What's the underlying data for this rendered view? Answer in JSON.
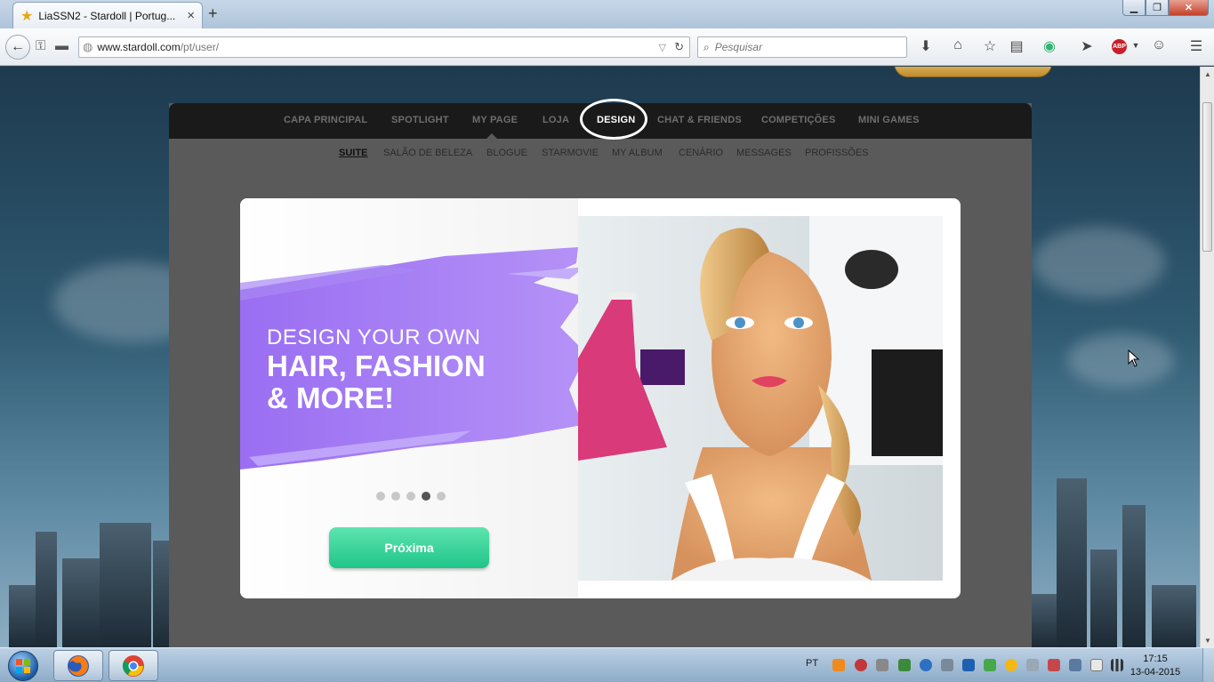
{
  "browser": {
    "tab_title": "LiaSSN2 - Stardoll | Portug...",
    "url_host": "www.stardoll.com",
    "url_path": "/pt/user/",
    "search_placeholder": "Pesquisar"
  },
  "site": {
    "main_nav": [
      {
        "label": "CAPA PRINCIPAL"
      },
      {
        "label": "SPOTLIGHT"
      },
      {
        "label": "MY PAGE"
      },
      {
        "label": "LOJA"
      },
      {
        "label": "DESIGN",
        "active": true
      },
      {
        "label": "CHAT & FRIENDS"
      },
      {
        "label": "COMPETIÇÕES"
      },
      {
        "label": "MINI GAMES"
      }
    ],
    "sub_nav": [
      {
        "label": "SUITE",
        "active": true
      },
      {
        "label": "SALÃO DE BELEZA"
      },
      {
        "label": "BLOGUE"
      },
      {
        "label": "STARMOVIE"
      },
      {
        "label": "MY ALBUM"
      },
      {
        "label": "CENÁRIO"
      },
      {
        "label": "MESSAGES"
      },
      {
        "label": "PROFISSÕES"
      }
    ]
  },
  "modal": {
    "headline_line1": "DESIGN YOUR OWN",
    "headline_line2": "HAIR, FASHION",
    "headline_line3": "& MORE!",
    "slide_count": 5,
    "active_slide": 4,
    "next_button": "Próxima"
  },
  "taskbar": {
    "language": "PT",
    "time": "17:15",
    "date": "13-04-2015"
  },
  "colors": {
    "brush_purple": "#9b6ff0",
    "next_green": "#2fd49a",
    "nav_dark": "#1a1a1a"
  }
}
